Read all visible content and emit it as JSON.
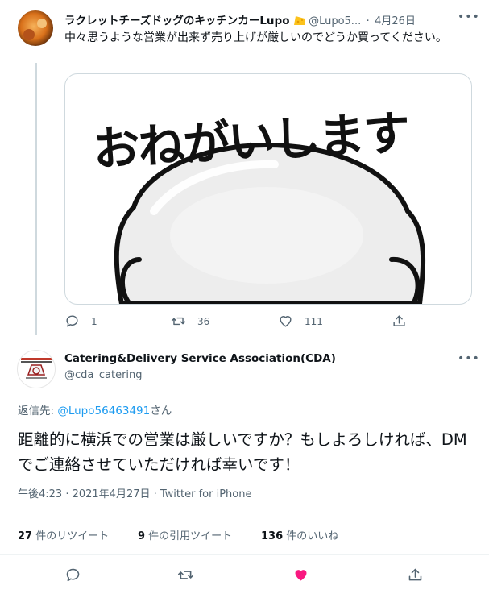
{
  "tweet1": {
    "name": "ラクレットチーズドッグのキッチンカーLupo",
    "handle": "@Lupo5...",
    "separator": "·",
    "date": "4月26日",
    "text": "中々思うような営業が出来ず売り上げが厳しいのでどうか買ってください。",
    "image_text": "おねがいします",
    "replies": "1",
    "retweets": "36",
    "likes": "111"
  },
  "tweet2": {
    "name": "Catering&Delivery Service Association(CDA)",
    "handle": "@cda_catering",
    "reply_prefix": "返信先: ",
    "reply_target": "@Lupo56463491",
    "reply_suffix": "さん",
    "text": "距離的に横浜での営業は厳しいですか？もしよろしければ、DMでご連絡させていただければ幸いです！",
    "time": "午後4:23 · 2021年4月27日 · ",
    "source": "Twitter for iPhone",
    "retweets_count": "27",
    "retweets_label": " 件のリツイート",
    "quotes_count": "9",
    "quotes_label": " 件の引用ツイート",
    "likes_count": "136",
    "likes_label": " 件のいいね"
  },
  "colors": {
    "accent": "#1d9bf0",
    "like": "#f91880",
    "muted": "#536471"
  }
}
